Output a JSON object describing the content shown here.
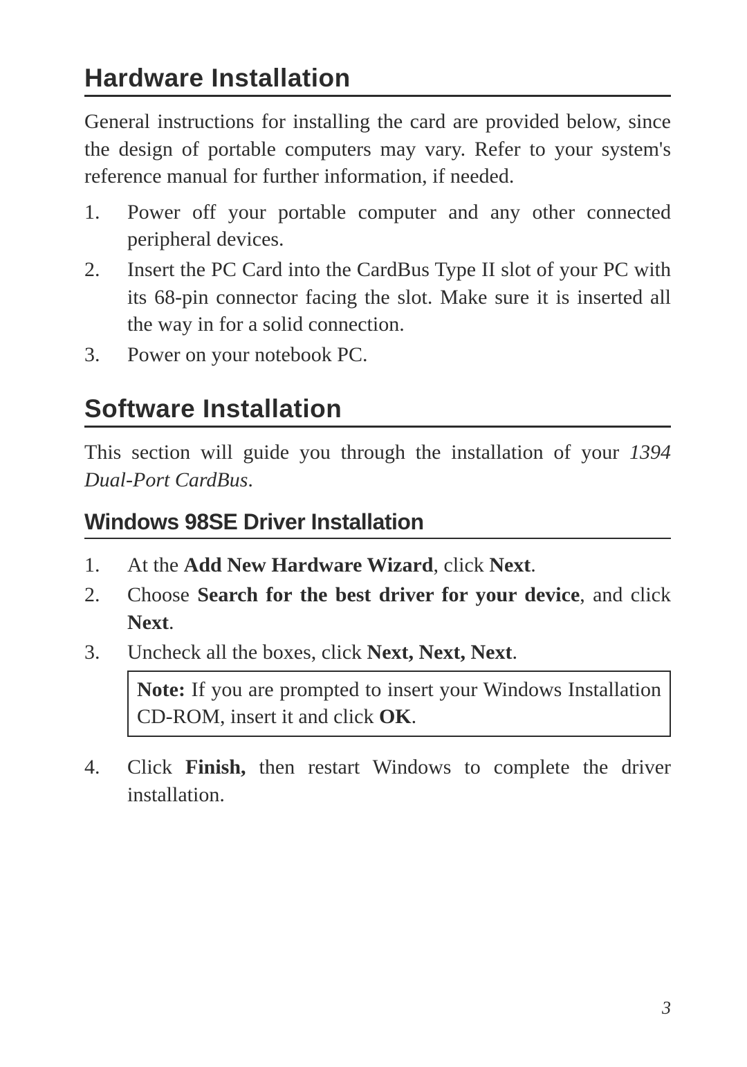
{
  "section1": {
    "heading": "Hardware  Installation",
    "intro": "General instructions for installing the card are provided below, since the design of portable computers may vary. Refer to your system's reference manual for further information, if needed.",
    "steps": [
      {
        "num": "1.",
        "text": "Power off your portable computer and any other connected peripheral devices."
      },
      {
        "num": "2.",
        "text": "Insert the PC Card into the CardBus Type II slot of your PC with its 68-pin connector facing the slot. Make sure it is inserted all the way in for a solid connection."
      },
      {
        "num": "3.",
        "text": "Power on your notebook PC."
      }
    ]
  },
  "section2": {
    "heading": "Software  Installation",
    "intro_pre": "This section will guide you through the installation of your ",
    "intro_italic": "1394 Dual-Port CardBus",
    "intro_post": ".",
    "sub": {
      "heading": "Windows 98SE Driver Installation",
      "steps": {
        "s1": {
          "num": "1.",
          "pre": "At the ",
          "b1": "Add New Hardware Wizard",
          "mid": ", click ",
          "b2": "Next",
          "post": "."
        },
        "s2": {
          "num": "2.",
          "pre": "Choose ",
          "b1": "Search for the best driver for your device",
          "mid": ", and click ",
          "b2": "Next",
          "post": "."
        },
        "s3": {
          "num": "3.",
          "pre": "Uncheck all the boxes, click ",
          "b1": "Next, Next, Next",
          "post": "."
        },
        "note": {
          "b1": "Note:",
          "mid": "  If you are prompted to insert your Windows Installation CD-ROM, insert it and click ",
          "b2": "OK",
          "post": "."
        },
        "s4": {
          "num": "4.",
          "pre": "Click ",
          "b1": "Finish,",
          "mid": " then restart Windows to complete the driver installation."
        }
      }
    }
  },
  "page_number": "3"
}
